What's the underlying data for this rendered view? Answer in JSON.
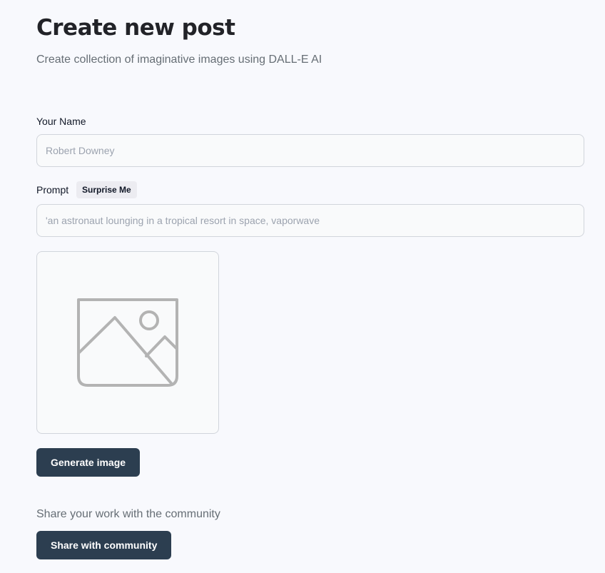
{
  "header": {
    "title": "Create new post",
    "subtitle": "Create collection of imaginative images using DALL-E AI"
  },
  "form": {
    "name_label": "Your Name",
    "name_placeholder": "Robert Downey",
    "name_value": "",
    "prompt_label": "Prompt",
    "surprise_label": "Surprise Me",
    "prompt_placeholder": "'an astronaut lounging in a tropical resort in space, vaporwave",
    "prompt_value": ""
  },
  "preview": {
    "icon": "image-placeholder-icon"
  },
  "actions": {
    "generate_label": "Generate image",
    "share_text": "Share your work with the community",
    "share_label": "Share with community"
  }
}
